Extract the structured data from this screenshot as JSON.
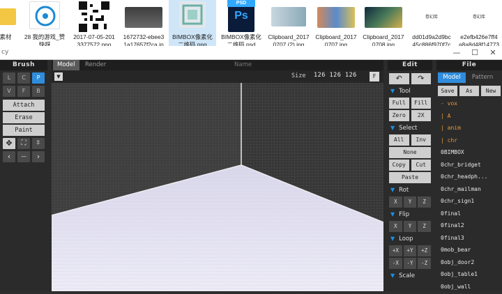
{
  "explorer": {
    "files": [
      {
        "caption": "素材",
        "thumb": "folder"
      },
      {
        "caption": "28 我的游戏_赞\n快呀",
        "thumb": "disc"
      },
      {
        "caption": "2017-07-05-201\n3377572.png",
        "thumb": "qr"
      },
      {
        "caption": "1672732-ebee3\n1a17657f2ca.jp",
        "thumb": "room"
      },
      {
        "caption": "BIMBOX像素化\n二维码.png",
        "thumb": "qr-small"
      },
      {
        "caption": "BIMBOX像素化\n二维码.psd",
        "thumb": "ps"
      },
      {
        "caption": "Clipboard_2017\n0707 (2).jpg",
        "thumb": "clip1"
      },
      {
        "caption": "Clipboard_2017\n0707.jpg",
        "thumb": "clip2"
      },
      {
        "caption": "Clipboard_2017\n0708.jpg",
        "thumb": "clip3"
      },
      {
        "caption": "dd01d9a2d9bc\n45c886f970f7c",
        "thumb": "text"
      },
      {
        "caption": "e2efb426e7ff4\na8a8d48f14773",
        "thumb": "text"
      }
    ],
    "thumb_text": "卷幻库",
    "ps_label": "Ps",
    "psd_label": "PSD"
  },
  "titlebar": {
    "title": "cy",
    "min": "—",
    "max": "☐",
    "close": "✕"
  },
  "brush": {
    "title": "Brush",
    "modes_row1": [
      "L",
      "C",
      "P"
    ],
    "modes_row2": [
      "V",
      "F",
      "B"
    ],
    "actions": [
      "Attach",
      "Erase",
      "Paint"
    ],
    "icons": [
      "move-icon",
      "select-box-icon",
      "pin-icon",
      "chevron-left-icon",
      "minus-icon",
      "chevron-right-icon"
    ],
    "glyphs": [
      "✥",
      "⛶",
      "⍏",
      "‹",
      "—",
      "›"
    ]
  },
  "viewport": {
    "tabs": [
      "Model",
      "Render",
      "Name"
    ],
    "size_label": "Size",
    "size_value": "126 126 126",
    "fit_btn": "F",
    "menu_glyph": "▼"
  },
  "edit": {
    "title": "Edit",
    "undo": "↶",
    "redo": "↷",
    "tool": {
      "label": "Tool",
      "buttons": [
        "Full",
        "Fill",
        "Zero",
        "2X"
      ]
    },
    "select": {
      "label": "Select",
      "buttons": [
        "All",
        "Inv",
        "None",
        "Copy",
        "Cut",
        "Paste"
      ]
    },
    "rot": {
      "label": "Rot",
      "buttons": [
        "X",
        "Y",
        "Z"
      ]
    },
    "flip": {
      "label": "Flip",
      "buttons": [
        "X",
        "Y",
        "Z"
      ]
    },
    "loop": {
      "label": "Loop",
      "buttons": [
        "+X",
        "+Y",
        "+Z",
        "-X",
        "-Y",
        "-Z"
      ]
    },
    "scale": {
      "label": "Scale"
    }
  },
  "filepanel": {
    "title": "File",
    "tabs": [
      "Model",
      "Pattern"
    ],
    "actions": [
      "Save",
      "As",
      "New"
    ],
    "items": [
      {
        "name": "- vox",
        "dir": true
      },
      {
        "name": "| A",
        "dir": true
      },
      {
        "name": "| anim",
        "dir": true
      },
      {
        "name": "| chr",
        "dir": true
      },
      {
        "name": "0BIMBOX",
        "dir": false
      },
      {
        "name": "0chr_bridget",
        "dir": false
      },
      {
        "name": "0chr_headph...",
        "dir": false
      },
      {
        "name": "0chr_mailman",
        "dir": false
      },
      {
        "name": "0chr_sign1",
        "dir": false
      },
      {
        "name": "0final",
        "dir": false
      },
      {
        "name": "0final2",
        "dir": false
      },
      {
        "name": "0final3",
        "dir": false
      },
      {
        "name": "0mob_bear",
        "dir": false
      },
      {
        "name": "0obj_door2",
        "dir": false
      },
      {
        "name": "0obj_table1",
        "dir": false
      },
      {
        "name": "0obj_wall",
        "dir": false
      }
    ]
  },
  "colors": {
    "accent": "#1c8fe0",
    "active_tab": "#2f8ddb",
    "dir_text": "#e89a3a"
  }
}
